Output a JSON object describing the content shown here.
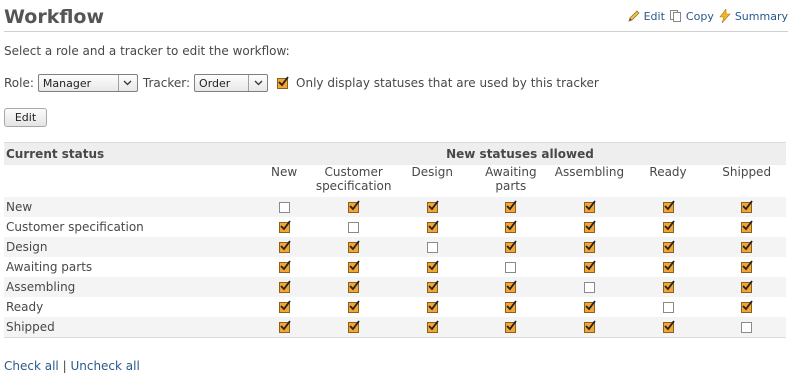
{
  "page": {
    "title": "Workflow",
    "intro": "Select a role and a tracker to edit the workflow:"
  },
  "actions": {
    "edit": "Edit",
    "copy": "Copy",
    "summary": "Summary"
  },
  "filters": {
    "role_label": "Role:",
    "role_value": "Manager",
    "tracker_label": "Tracker:",
    "tracker_value": "Order",
    "only_used_checked": true,
    "only_used_label": "Only display statuses that are used by this tracker"
  },
  "edit_button": "Edit",
  "table": {
    "current_status_header": "Current status",
    "new_statuses_header": "New statuses allowed",
    "columns": [
      "New",
      "Customer\nspecification",
      "Design",
      "Awaiting\nparts",
      "Assembling",
      "Ready",
      "Shipped"
    ],
    "rows": [
      {
        "name": "New",
        "checks": [
          false,
          true,
          true,
          true,
          true,
          true,
          true
        ]
      },
      {
        "name": "Customer specification",
        "checks": [
          true,
          false,
          true,
          true,
          true,
          true,
          true
        ]
      },
      {
        "name": "Design",
        "checks": [
          true,
          true,
          false,
          true,
          true,
          true,
          true
        ]
      },
      {
        "name": "Awaiting parts",
        "checks": [
          true,
          true,
          true,
          false,
          true,
          true,
          true
        ]
      },
      {
        "name": "Assembling",
        "checks": [
          true,
          true,
          true,
          true,
          false,
          true,
          true
        ]
      },
      {
        "name": "Ready",
        "checks": [
          true,
          true,
          true,
          true,
          true,
          false,
          true
        ]
      },
      {
        "name": "Shipped",
        "checks": [
          true,
          true,
          true,
          true,
          true,
          true,
          false
        ]
      }
    ]
  },
  "footer": {
    "check_all": "Check all",
    "separator": "|",
    "uncheck_all": "Uncheck all"
  },
  "colors": {
    "link": "#2a5a8a",
    "checkbox_checked": "#f4a533",
    "header_bg": "#eeeeee"
  }
}
